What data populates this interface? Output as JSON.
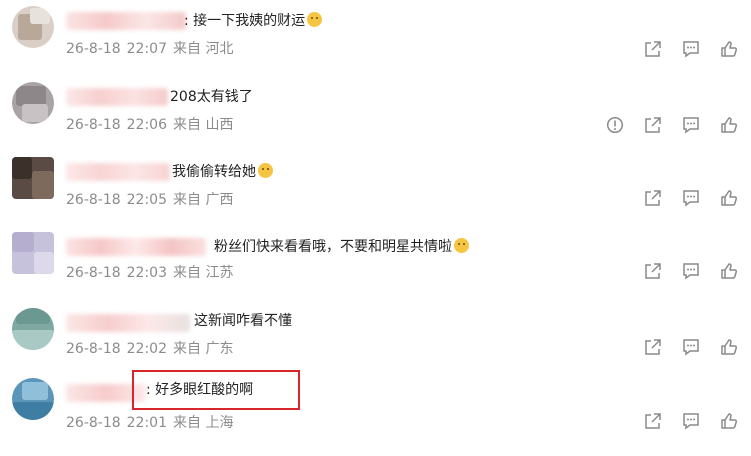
{
  "colors": {
    "text": "#222222",
    "meta": "#8c8c8c",
    "icon": "#8a8a8a",
    "highlight": "#d9262b"
  },
  "comments": [
    {
      "text": ": 接一下我姨的财运",
      "emoji": "emoji-crying-laughing",
      "date": "26-8-18",
      "time": "22:07",
      "location": "来自 河北",
      "has_report": false
    },
    {
      "text": "208太有钱了",
      "emoji": "",
      "date": "26-8-18",
      "time": "22:06",
      "location": "来自 山西",
      "has_report": true
    },
    {
      "text": "我偷偷转给她",
      "emoji": "emoji-smirk",
      "date": "26-8-18",
      "time": "22:05",
      "location": "来自 广西",
      "has_report": false
    },
    {
      "text": "粉丝们快来看看哦，不要和明星共情啦",
      "emoji": "emoji-laughing",
      "date": "26-8-18",
      "time": "22:03",
      "location": "来自 江苏",
      "has_report": false
    },
    {
      "text": "这新闻咋看不懂",
      "emoji": "",
      "date": "26-8-18",
      "time": "22:02",
      "location": "来自 广东",
      "has_report": false
    },
    {
      "text": ": 好多眼红酸的啊",
      "emoji": "",
      "date": "26-8-18",
      "time": "22:01",
      "location": "来自 上海",
      "has_report": false,
      "highlighted": true
    }
  ]
}
